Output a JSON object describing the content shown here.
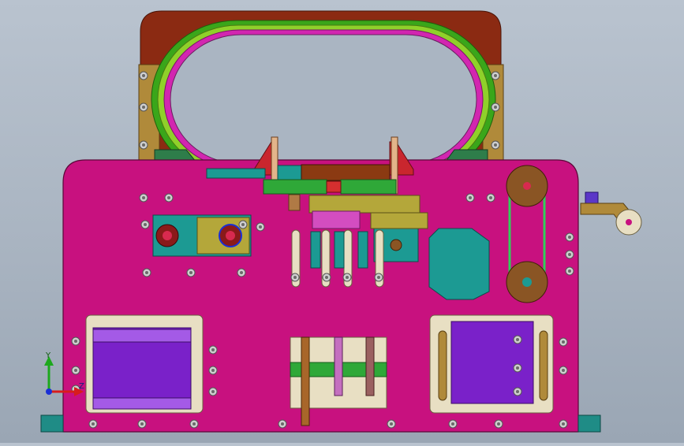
{
  "viewport": {
    "background_top": "#b9c3cf",
    "background_bottom": "#9aa6b4"
  },
  "colors": {
    "frame_plate": "#c8117f",
    "upper_frame": "#8b2a12",
    "green_ring": "#3aa61a",
    "lime_ring": "#8fd12a",
    "magenta_ring": "#d226b0",
    "teal": "#1c9a93",
    "olive": "#b4a73a",
    "purple_panel": "#7a21c9",
    "cream_panel": "#e8dfc3",
    "pulley_brown": "#8a5524",
    "base_foot": "#1f8c86",
    "bolt": "#cfcfcf",
    "axis_x": "#d81c1c",
    "axis_y": "#1da81d",
    "axis_z": "#1a2fd6"
  },
  "triad": {
    "y_label": "Y",
    "z_label": "Z"
  }
}
